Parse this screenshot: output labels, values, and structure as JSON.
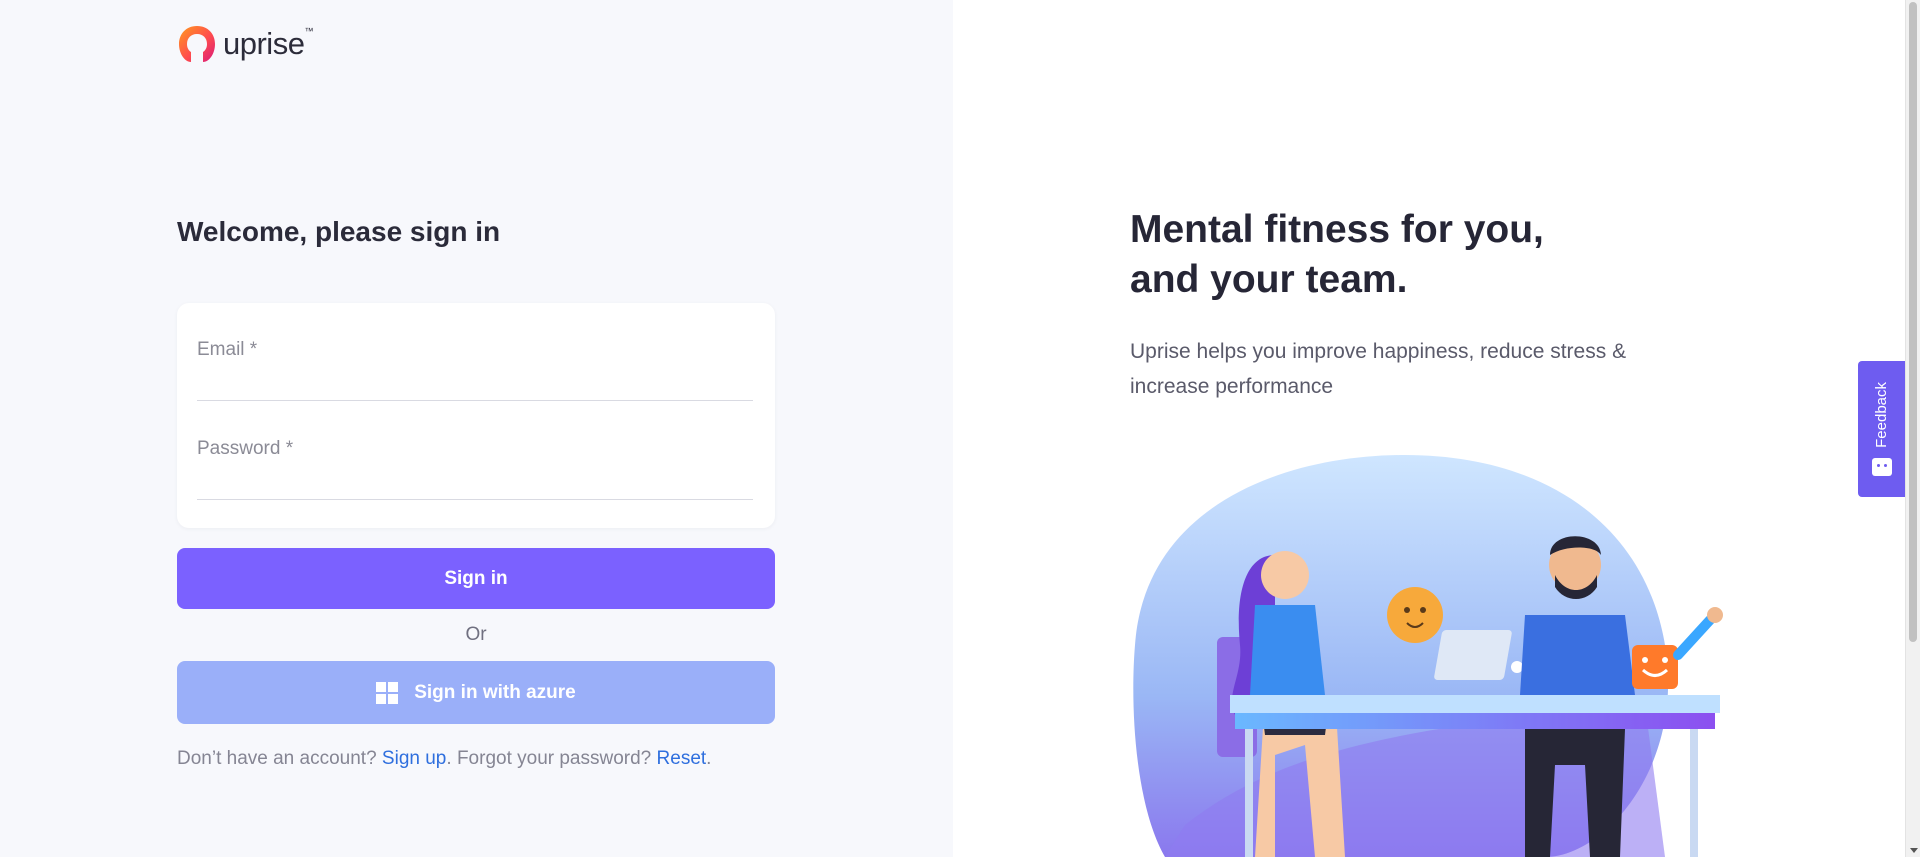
{
  "brand": {
    "name": "uprise",
    "trademark": "™"
  },
  "signin": {
    "heading": "Welcome, please sign in",
    "email_label": "Email *",
    "email_value": "",
    "password_label": "Password *",
    "password_value": "",
    "sign_in_label": "Sign in",
    "or_label": "Or",
    "azure_label": "Sign in with azure",
    "azure_icon": "windows-icon"
  },
  "footer": {
    "no_account": "Don’t have an account? ",
    "sign_up": "Sign up",
    "period1": ". ",
    "forgot": "Forgot your password? ",
    "reset": "Reset",
    "period2": "."
  },
  "hero": {
    "headline_line1": "Mental fitness for you,",
    "headline_line2": "and your team.",
    "subtitle": "Uprise helps you improve happiness, reduce stress & increase performance"
  },
  "feedback": {
    "label": "Feedback",
    "icon": "smile-chat-icon"
  },
  "colors": {
    "primary": "#7b61ff",
    "azure": "#9aaff9",
    "link": "#2f6fde",
    "left_bg": "#f7f8fc",
    "feedback": "#6e5cf0"
  }
}
